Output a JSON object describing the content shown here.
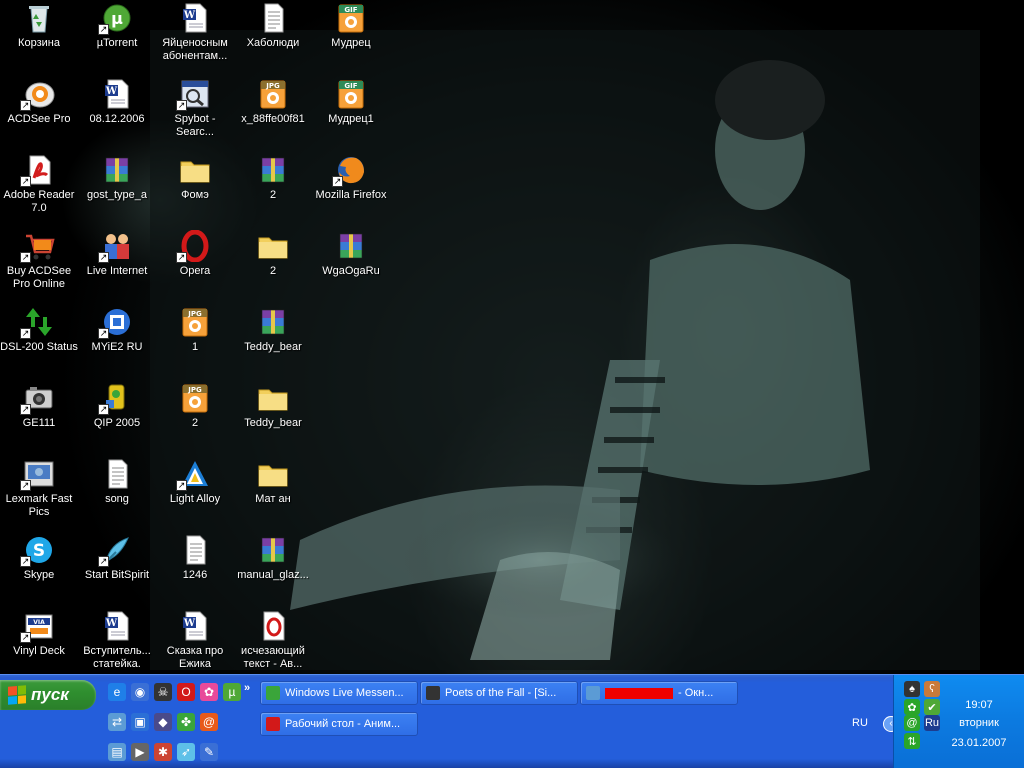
{
  "desktop": {
    "icons": [
      {
        "label": "Корзина",
        "icon": "recycle-bin-icon",
        "shortcut": false
      },
      {
        "label": "µTorrent",
        "icon": "utorrent-icon",
        "shortcut": true
      },
      {
        "label": "Яйценосным абонентам...",
        "icon": "word-document-icon",
        "shortcut": false
      },
      {
        "label": "Хаболюди",
        "icon": "text-document-icon",
        "shortcut": false
      },
      {
        "label": "Мудрец",
        "icon": "gif-image-icon",
        "shortcut": false
      },
      {
        "label": "ACDSee Pro",
        "icon": "acdsee-icon",
        "shortcut": true
      },
      {
        "label": "08.12.2006",
        "icon": "word-document-icon",
        "shortcut": false
      },
      {
        "label": "Spybot - Searc...",
        "icon": "spybot-icon",
        "shortcut": true
      },
      {
        "label": "x_88ffe00f81",
        "icon": "jpg-image-icon",
        "shortcut": false
      },
      {
        "label": "Мудрец1",
        "icon": "gif-image-icon",
        "shortcut": false
      },
      {
        "label": "Adobe Reader 7.0",
        "icon": "adobe-reader-icon",
        "shortcut": true
      },
      {
        "label": "gost_type_a",
        "icon": "winrar-archive-icon",
        "shortcut": false
      },
      {
        "label": "Фомэ",
        "icon": "folder-icon",
        "shortcut": false
      },
      {
        "label": "2",
        "icon": "winrar-archive-icon",
        "shortcut": false
      },
      {
        "label": "Mozilla Firefox",
        "icon": "firefox-icon",
        "shortcut": true
      },
      {
        "label": "Buy ACDSee Pro Online",
        "icon": "shopping-cart-icon",
        "shortcut": true
      },
      {
        "label": "Live Internet",
        "icon": "live-internet-icon",
        "shortcut": true
      },
      {
        "label": "Opera",
        "icon": "opera-icon",
        "shortcut": true
      },
      {
        "label": "2",
        "icon": "folder-icon",
        "shortcut": false
      },
      {
        "label": "WgaOgaRu",
        "icon": "winrar-archive-icon",
        "shortcut": false
      },
      {
        "label": "DSL-200 Status",
        "icon": "network-arrows-icon",
        "shortcut": true
      },
      {
        "label": "MYiE2 RU",
        "icon": "myie2-icon",
        "shortcut": true
      },
      {
        "label": "1",
        "icon": "jpg-image-icon",
        "shortcut": false
      },
      {
        "label": "Teddy_bear",
        "icon": "winrar-archive-icon",
        "shortcut": false
      },
      {
        "label": "GE111",
        "icon": "camera-icon",
        "shortcut": true
      },
      {
        "label": "QIP 2005",
        "icon": "qip-icon",
        "shortcut": true
      },
      {
        "label": "2",
        "icon": "jpg-image-icon",
        "shortcut": false
      },
      {
        "label": "Teddy_bear",
        "icon": "folder-icon",
        "shortcut": false
      },
      {
        "label": "Lexmark Fast Pics",
        "icon": "lexmark-icon",
        "shortcut": true
      },
      {
        "label": "song",
        "icon": "text-document-icon",
        "shortcut": false
      },
      {
        "label": "Light Alloy",
        "icon": "light-alloy-icon",
        "shortcut": true
      },
      {
        "label": "Мат ан",
        "icon": "folder-icon",
        "shortcut": false
      },
      {
        "label": "Skype",
        "icon": "skype-icon",
        "shortcut": true
      },
      {
        "label": "Start BitSpirit",
        "icon": "bitspirit-icon",
        "shortcut": true
      },
      {
        "label": "1246",
        "icon": "text-document-icon",
        "shortcut": false
      },
      {
        "label": "manual_glaz...",
        "icon": "winrar-archive-icon",
        "shortcut": false
      },
      {
        "label": "Vinyl Deck",
        "icon": "vinyl-deck-icon",
        "shortcut": true
      },
      {
        "label": "Вступитель... статейка.",
        "icon": "word-document-icon",
        "shortcut": false
      },
      {
        "label": "Сказка про Ежика",
        "icon": "word-document-icon",
        "shortcut": false
      },
      {
        "label": "исчезающий текст - Ав...",
        "icon": "opera-document-icon",
        "shortcut": false
      }
    ]
  },
  "taskbar": {
    "start_label": "пуск",
    "chevron": "»",
    "quick_launch": [
      "internet-explorer-icon",
      "browser-icon",
      "skull-icon",
      "opera-icon",
      "flower-icon",
      "utorrent-icon",
      "network-icon",
      "myie2-icon",
      "drop-icon",
      "qip-icon",
      "at-sign-icon",
      "document-icon",
      "media-player-icon",
      "bug-icon",
      "bitspirit-icon",
      "pen-icon"
    ],
    "tasks": [
      {
        "label": "Windows Live Messen...",
        "icon": "messenger-icon"
      },
      {
        "label": "Poets of the Fall - [Si...",
        "icon": "skull-icon"
      },
      {
        "label": "- Окн...",
        "icon": "window-icon",
        "redacted": true
      },
      {
        "label": "Рабочий стол - Аним...",
        "icon": "opera-icon"
      }
    ],
    "language": "RU",
    "tray_expand": "‹",
    "clock": {
      "time": "19:07",
      "day": "вторник",
      "date": "23.01.2007"
    },
    "tray_icons": [
      "drop-icon",
      "bear-icon",
      "qip-flower-icon",
      "check-icon",
      "at-sign-icon",
      "ru-keyboard-icon",
      "network-arrows-icon"
    ],
    "tray_ru": "Ru"
  }
}
